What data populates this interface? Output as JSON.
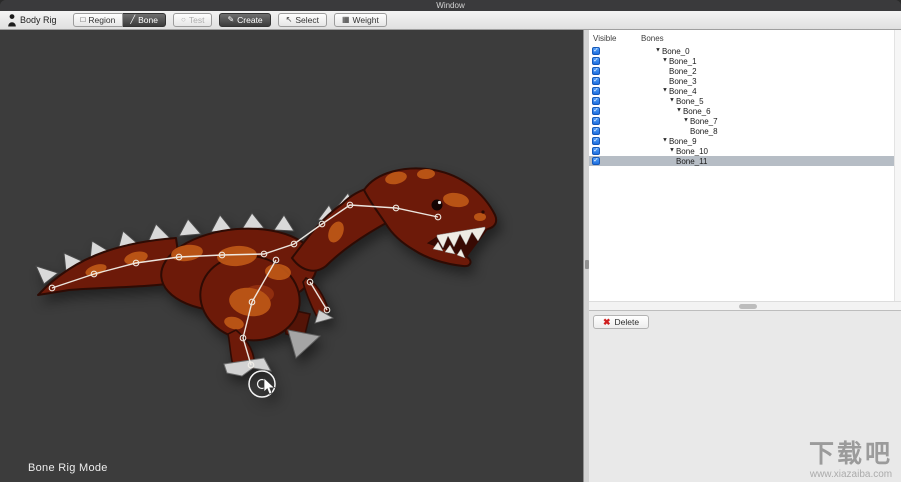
{
  "titlebar": {
    "title": "Window"
  },
  "toolbar": {
    "app_label": "Body Rig",
    "buttons": [
      {
        "label": "Region",
        "icon": "region",
        "state": "normal"
      },
      {
        "label": "Bone",
        "icon": "bone",
        "state": "active"
      },
      {
        "label": "Test",
        "icon": "test",
        "state": "disabled"
      },
      {
        "label": "Create",
        "icon": "create",
        "state": "active"
      },
      {
        "label": "Select",
        "icon": "select",
        "state": "normal"
      },
      {
        "label": "Weight",
        "icon": "weight",
        "state": "normal"
      }
    ]
  },
  "canvas": {
    "mode_label": "Bone Rig Mode"
  },
  "panel": {
    "columns": {
      "visible": "Visible",
      "bones": "Bones"
    },
    "delete_label": "Delete",
    "bones": [
      {
        "name": "Bone_0",
        "depth": 0,
        "expanded": true,
        "visible": true,
        "selected": false
      },
      {
        "name": "Bone_1",
        "depth": 1,
        "expanded": true,
        "visible": true,
        "selected": false
      },
      {
        "name": "Bone_2",
        "depth": 2,
        "expanded": false,
        "visible": true,
        "selected": false
      },
      {
        "name": "Bone_3",
        "depth": 2,
        "expanded": false,
        "visible": true,
        "selected": false
      },
      {
        "name": "Bone_4",
        "depth": 1,
        "expanded": true,
        "visible": true,
        "selected": false
      },
      {
        "name": "Bone_5",
        "depth": 2,
        "expanded": true,
        "visible": true,
        "selected": false
      },
      {
        "name": "Bone_6",
        "depth": 3,
        "expanded": true,
        "visible": true,
        "selected": false
      },
      {
        "name": "Bone_7",
        "depth": 4,
        "expanded": true,
        "visible": true,
        "selected": false
      },
      {
        "name": "Bone_8",
        "depth": 5,
        "expanded": false,
        "visible": true,
        "selected": false
      },
      {
        "name": "Bone_9",
        "depth": 1,
        "expanded": true,
        "visible": true,
        "selected": false
      },
      {
        "name": "Bone_10",
        "depth": 2,
        "expanded": true,
        "visible": true,
        "selected": false
      },
      {
        "name": "Bone_11",
        "depth": 3,
        "expanded": false,
        "visible": true,
        "selected": true
      }
    ]
  },
  "icons": {
    "region": "□",
    "bone": "╱",
    "test": "○",
    "create": "✎",
    "select": "↖",
    "weight": "▦",
    "delete_x": "✖",
    "check": "✓",
    "expander": "▼"
  },
  "watermark": {
    "title": "下载吧",
    "url": "www.xiazaiba.com"
  }
}
